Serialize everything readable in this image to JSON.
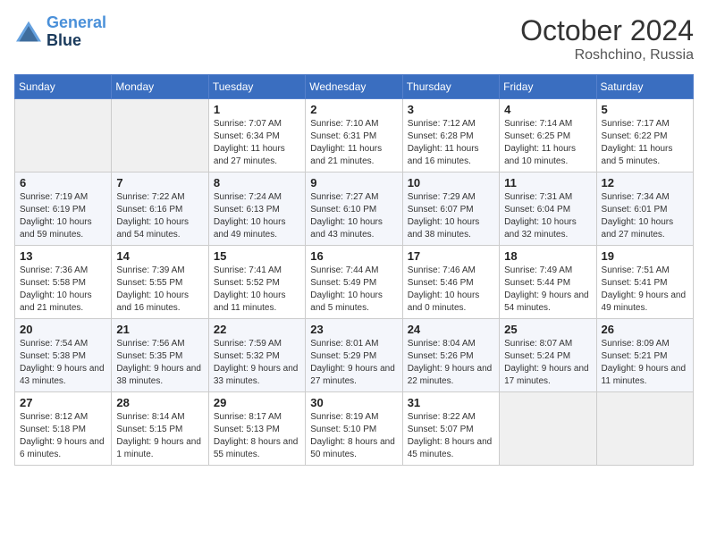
{
  "header": {
    "logo_line1": "General",
    "logo_line2": "Blue",
    "month_title": "October 2024",
    "subtitle": "Roshchino, Russia"
  },
  "weekdays": [
    "Sunday",
    "Monday",
    "Tuesday",
    "Wednesday",
    "Thursday",
    "Friday",
    "Saturday"
  ],
  "weeks": [
    [
      {
        "day": "",
        "info": ""
      },
      {
        "day": "",
        "info": ""
      },
      {
        "day": "1",
        "info": "Sunrise: 7:07 AM\nSunset: 6:34 PM\nDaylight: 11 hours and 27 minutes."
      },
      {
        "day": "2",
        "info": "Sunrise: 7:10 AM\nSunset: 6:31 PM\nDaylight: 11 hours and 21 minutes."
      },
      {
        "day": "3",
        "info": "Sunrise: 7:12 AM\nSunset: 6:28 PM\nDaylight: 11 hours and 16 minutes."
      },
      {
        "day": "4",
        "info": "Sunrise: 7:14 AM\nSunset: 6:25 PM\nDaylight: 11 hours and 10 minutes."
      },
      {
        "day": "5",
        "info": "Sunrise: 7:17 AM\nSunset: 6:22 PM\nDaylight: 11 hours and 5 minutes."
      }
    ],
    [
      {
        "day": "6",
        "info": "Sunrise: 7:19 AM\nSunset: 6:19 PM\nDaylight: 10 hours and 59 minutes."
      },
      {
        "day": "7",
        "info": "Sunrise: 7:22 AM\nSunset: 6:16 PM\nDaylight: 10 hours and 54 minutes."
      },
      {
        "day": "8",
        "info": "Sunrise: 7:24 AM\nSunset: 6:13 PM\nDaylight: 10 hours and 49 minutes."
      },
      {
        "day": "9",
        "info": "Sunrise: 7:27 AM\nSunset: 6:10 PM\nDaylight: 10 hours and 43 minutes."
      },
      {
        "day": "10",
        "info": "Sunrise: 7:29 AM\nSunset: 6:07 PM\nDaylight: 10 hours and 38 minutes."
      },
      {
        "day": "11",
        "info": "Sunrise: 7:31 AM\nSunset: 6:04 PM\nDaylight: 10 hours and 32 minutes."
      },
      {
        "day": "12",
        "info": "Sunrise: 7:34 AM\nSunset: 6:01 PM\nDaylight: 10 hours and 27 minutes."
      }
    ],
    [
      {
        "day": "13",
        "info": "Sunrise: 7:36 AM\nSunset: 5:58 PM\nDaylight: 10 hours and 21 minutes."
      },
      {
        "day": "14",
        "info": "Sunrise: 7:39 AM\nSunset: 5:55 PM\nDaylight: 10 hours and 16 minutes."
      },
      {
        "day": "15",
        "info": "Sunrise: 7:41 AM\nSunset: 5:52 PM\nDaylight: 10 hours and 11 minutes."
      },
      {
        "day": "16",
        "info": "Sunrise: 7:44 AM\nSunset: 5:49 PM\nDaylight: 10 hours and 5 minutes."
      },
      {
        "day": "17",
        "info": "Sunrise: 7:46 AM\nSunset: 5:46 PM\nDaylight: 10 hours and 0 minutes."
      },
      {
        "day": "18",
        "info": "Sunrise: 7:49 AM\nSunset: 5:44 PM\nDaylight: 9 hours and 54 minutes."
      },
      {
        "day": "19",
        "info": "Sunrise: 7:51 AM\nSunset: 5:41 PM\nDaylight: 9 hours and 49 minutes."
      }
    ],
    [
      {
        "day": "20",
        "info": "Sunrise: 7:54 AM\nSunset: 5:38 PM\nDaylight: 9 hours and 43 minutes."
      },
      {
        "day": "21",
        "info": "Sunrise: 7:56 AM\nSunset: 5:35 PM\nDaylight: 9 hours and 38 minutes."
      },
      {
        "day": "22",
        "info": "Sunrise: 7:59 AM\nSunset: 5:32 PM\nDaylight: 9 hours and 33 minutes."
      },
      {
        "day": "23",
        "info": "Sunrise: 8:01 AM\nSunset: 5:29 PM\nDaylight: 9 hours and 27 minutes."
      },
      {
        "day": "24",
        "info": "Sunrise: 8:04 AM\nSunset: 5:26 PM\nDaylight: 9 hours and 22 minutes."
      },
      {
        "day": "25",
        "info": "Sunrise: 8:07 AM\nSunset: 5:24 PM\nDaylight: 9 hours and 17 minutes."
      },
      {
        "day": "26",
        "info": "Sunrise: 8:09 AM\nSunset: 5:21 PM\nDaylight: 9 hours and 11 minutes."
      }
    ],
    [
      {
        "day": "27",
        "info": "Sunrise: 8:12 AM\nSunset: 5:18 PM\nDaylight: 9 hours and 6 minutes."
      },
      {
        "day": "28",
        "info": "Sunrise: 8:14 AM\nSunset: 5:15 PM\nDaylight: 9 hours and 1 minute."
      },
      {
        "day": "29",
        "info": "Sunrise: 8:17 AM\nSunset: 5:13 PM\nDaylight: 8 hours and 55 minutes."
      },
      {
        "day": "30",
        "info": "Sunrise: 8:19 AM\nSunset: 5:10 PM\nDaylight: 8 hours and 50 minutes."
      },
      {
        "day": "31",
        "info": "Sunrise: 8:22 AM\nSunset: 5:07 PM\nDaylight: 8 hours and 45 minutes."
      },
      {
        "day": "",
        "info": ""
      },
      {
        "day": "",
        "info": ""
      }
    ]
  ]
}
